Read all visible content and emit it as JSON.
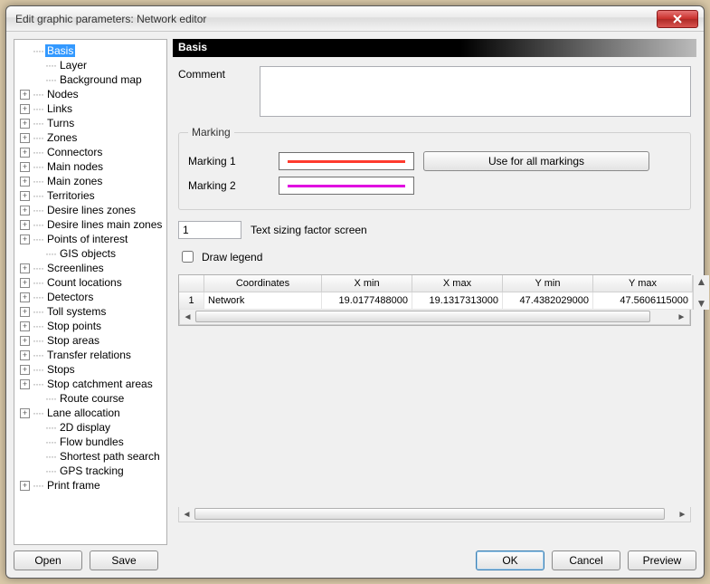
{
  "window": {
    "title": "Edit graphic parameters: Network editor"
  },
  "tree": {
    "items": [
      {
        "label": "Basis",
        "expandable": false,
        "selected": true,
        "indent": 0
      },
      {
        "label": "Layer",
        "expandable": false,
        "indent": 1
      },
      {
        "label": "Background map",
        "expandable": false,
        "indent": 1
      },
      {
        "label": "Nodes",
        "expandable": true,
        "indent": 0
      },
      {
        "label": "Links",
        "expandable": true,
        "indent": 0
      },
      {
        "label": "Turns",
        "expandable": true,
        "indent": 0
      },
      {
        "label": "Zones",
        "expandable": true,
        "indent": 0
      },
      {
        "label": "Connectors",
        "expandable": true,
        "indent": 0
      },
      {
        "label": "Main nodes",
        "expandable": true,
        "indent": 0
      },
      {
        "label": "Main zones",
        "expandable": true,
        "indent": 0
      },
      {
        "label": "Territories",
        "expandable": true,
        "indent": 0
      },
      {
        "label": "Desire lines zones",
        "expandable": true,
        "indent": 0
      },
      {
        "label": "Desire lines main zones",
        "expandable": true,
        "indent": 0
      },
      {
        "label": "Points of interest",
        "expandable": true,
        "indent": 0
      },
      {
        "label": "GIS objects",
        "expandable": false,
        "indent": 1
      },
      {
        "label": "Screenlines",
        "expandable": true,
        "indent": 0
      },
      {
        "label": "Count locations",
        "expandable": true,
        "indent": 0
      },
      {
        "label": "Detectors",
        "expandable": true,
        "indent": 0
      },
      {
        "label": "Toll systems",
        "expandable": true,
        "indent": 0
      },
      {
        "label": "Stop points",
        "expandable": true,
        "indent": 0
      },
      {
        "label": "Stop areas",
        "expandable": true,
        "indent": 0
      },
      {
        "label": "Transfer relations",
        "expandable": true,
        "indent": 0
      },
      {
        "label": "Stops",
        "expandable": true,
        "indent": 0
      },
      {
        "label": "Stop catchment areas",
        "expandable": true,
        "indent": 0
      },
      {
        "label": "Route course",
        "expandable": false,
        "indent": 1
      },
      {
        "label": "Lane allocation",
        "expandable": true,
        "indent": 0
      },
      {
        "label": "2D display",
        "expandable": false,
        "indent": 1
      },
      {
        "label": "Flow bundles",
        "expandable": false,
        "indent": 1
      },
      {
        "label": "Shortest path search",
        "expandable": false,
        "indent": 1
      },
      {
        "label": "GPS tracking",
        "expandable": false,
        "indent": 1
      },
      {
        "label": "Print frame",
        "expandable": true,
        "indent": 0
      }
    ]
  },
  "panel": {
    "header": "Basis",
    "comment_label": "Comment",
    "comment_value": "",
    "marking": {
      "legend": "Marking",
      "row1_label": "Marking 1",
      "row1_color": "#ff3b2f",
      "row2_label": "Marking 2",
      "row2_color": "#e000e0",
      "use_all_label": "Use for all markings"
    },
    "sizing": {
      "value": "1",
      "label": "Text sizing factor screen"
    },
    "draw_legend": {
      "label": "Draw legend",
      "checked": false
    },
    "grid": {
      "headers": [
        "",
        "Coordinates",
        "X min",
        "X max",
        "Y min",
        "Y max"
      ],
      "rows": [
        {
          "num": "1",
          "coords": "Network",
          "xmin": "19.0177488000",
          "xmax": "19.1317313000",
          "ymin": "47.4382029000",
          "ymax": "47.5606115000"
        }
      ]
    }
  },
  "footer": {
    "open": "Open",
    "save": "Save",
    "ok": "OK",
    "cancel": "Cancel",
    "preview": "Preview"
  }
}
